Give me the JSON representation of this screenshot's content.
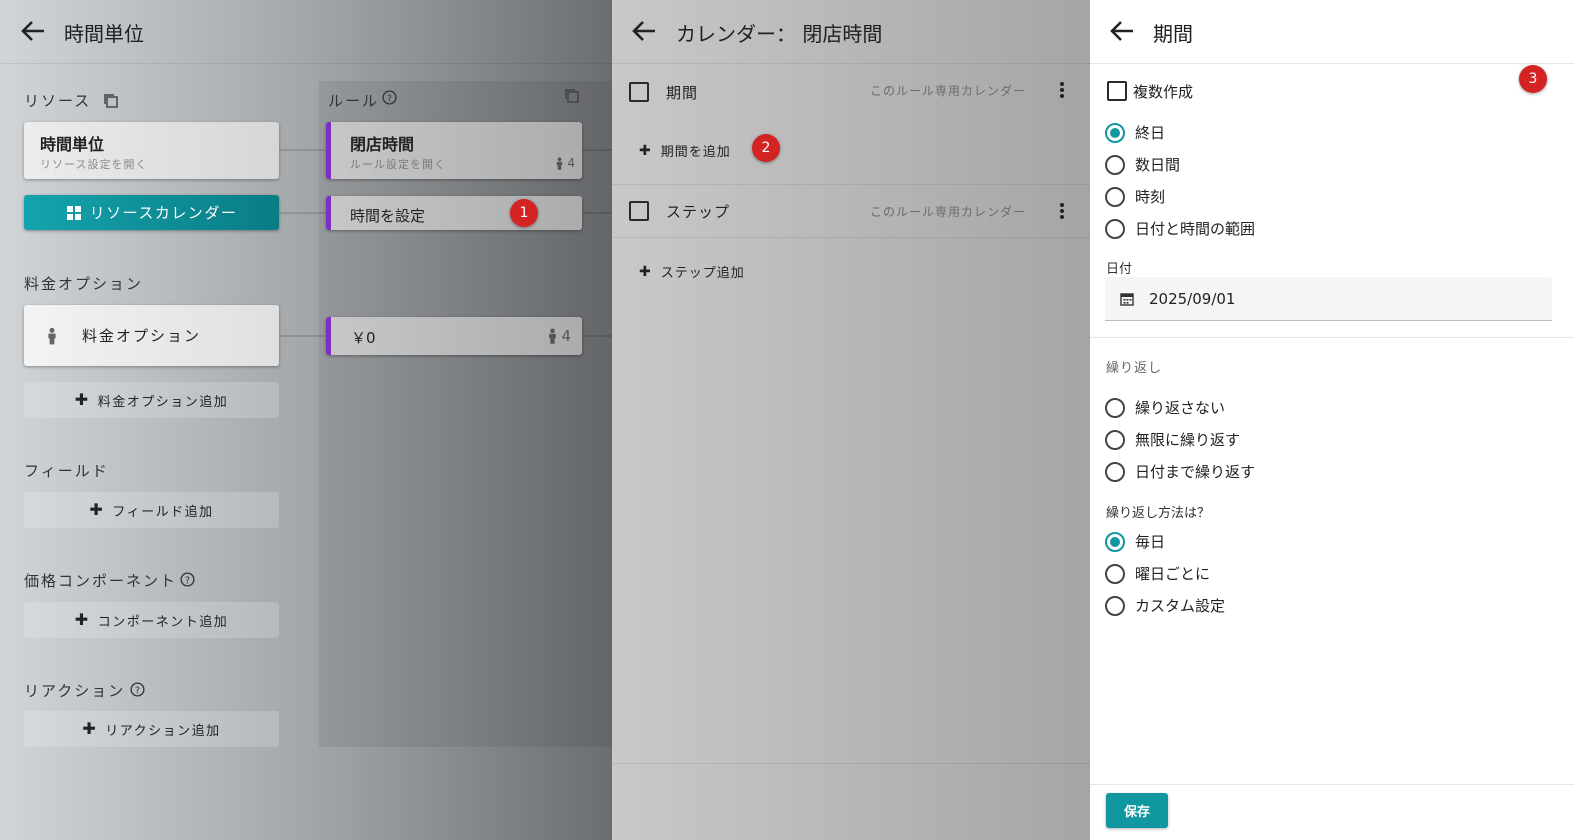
{
  "panel1": {
    "title": "時間単位",
    "resources_label": "リソース",
    "rules_label": "ルール",
    "resource_card": {
      "title": "時間単位",
      "subtitle": "リソース設定を開く"
    },
    "resource_calendar_button": "リソースカレンダー",
    "rule_card": {
      "title": "閉店時間",
      "subtitle": "ルール設定を開く",
      "count": "4"
    },
    "set_time_card": {
      "label": "時間を設定"
    },
    "pricing_label": "料金オプション",
    "pricing_card": {
      "label": "料金オプション"
    },
    "price_card": {
      "value": "￥0",
      "count": "4"
    },
    "add_pricing_button": "料金オプション追加",
    "fields_label": "フィールド",
    "add_field_button": "フィールド追加",
    "price_components_label": "価格コンポーネント",
    "add_component_button": "コンポーネント追加",
    "reactions_label": "リアクション",
    "add_reaction_button": "リアクション追加",
    "badge_1": "1"
  },
  "panel2": {
    "title": "カレンダー： 閉店時間",
    "rows": [
      {
        "label": "期間",
        "meta": "このルール専用カレンダー"
      },
      {
        "label": "ステップ",
        "meta": "このルール専用カレンダー"
      }
    ],
    "add_period": "期間を追加",
    "add_step": "ステップ追加",
    "badge_2": "2"
  },
  "panel3": {
    "title": "期間",
    "multi_create": "複数作成",
    "badge_3": "3",
    "period_options": [
      "終日",
      "数日間",
      "時刻",
      "日付と時間の範囲"
    ],
    "period_selected": 0,
    "date_label": "日付",
    "date_value": "2025/09/01",
    "repeat_label": "繰り返し",
    "repeat_options": [
      "繰り返さない",
      "無限に繰り返す",
      "日付まで繰り返す"
    ],
    "repeat_selected": 1,
    "repeat_method_label": "繰り返し方法は？",
    "method_options": [
      "毎日",
      "曜日ごとに",
      "カスタム設定"
    ],
    "method_selected": 0,
    "save_button": "保存"
  },
  "colors": {
    "accent": "#1197a0",
    "rule_accent": "#7b2fc9",
    "badge": "#d42323"
  },
  "icons": [
    "back-arrow-icon",
    "copy-icon",
    "help-icon",
    "grid-icon",
    "person-icon",
    "plus-icon",
    "kebab-icon",
    "calendar-icon"
  ]
}
